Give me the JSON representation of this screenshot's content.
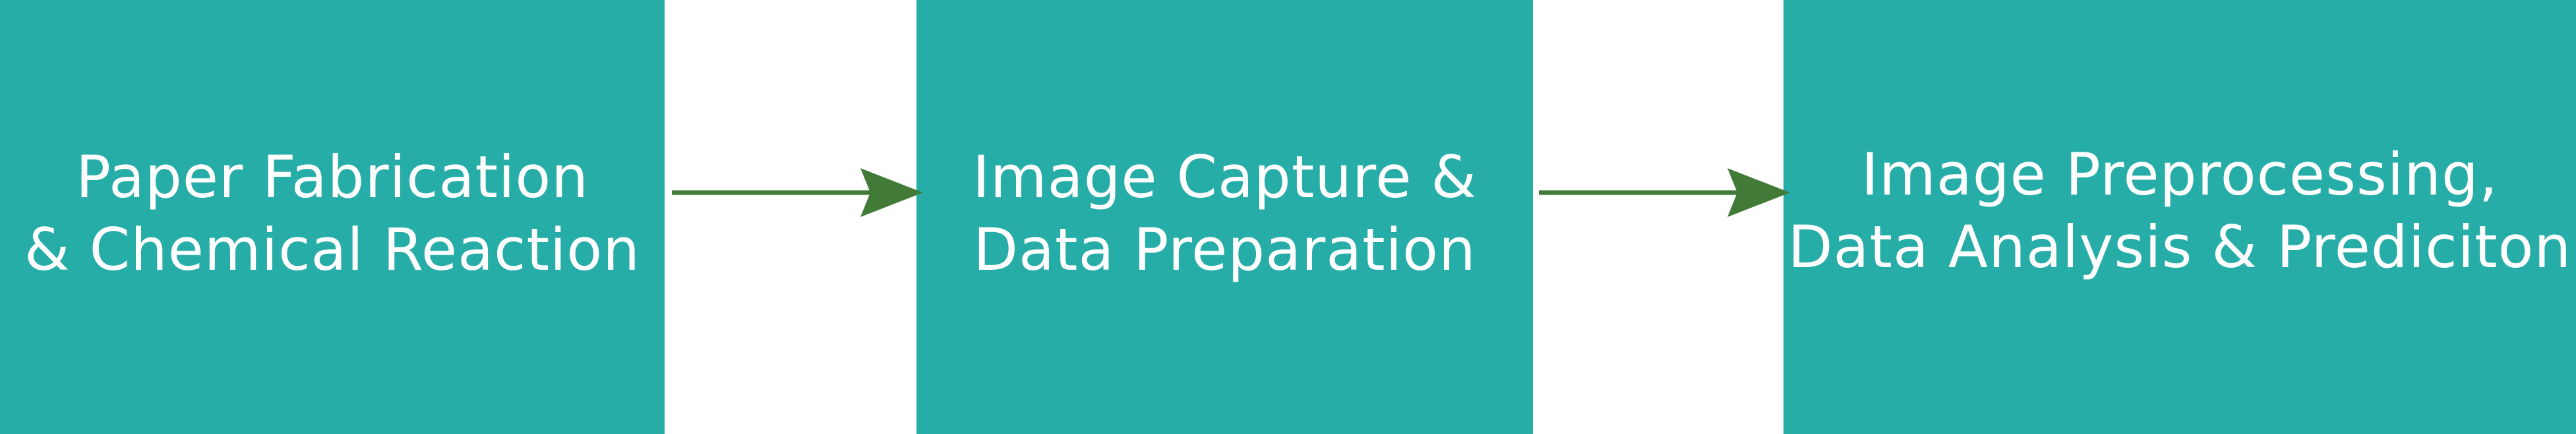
{
  "diagram": {
    "colors": {
      "box_fill": "#27ada8",
      "text": "#ffffff",
      "arrow": "#427b38",
      "background": "#ffffff"
    },
    "steps": [
      {
        "label": "Paper Fabrication\n& Chemical Reaction"
      },
      {
        "label": "Image Capture &\nData Preparation"
      },
      {
        "label": "Image Preprocessing,\nData Analysis & Prediciton"
      }
    ],
    "connections": [
      {
        "from": 0,
        "to": 1
      },
      {
        "from": 1,
        "to": 2
      }
    ]
  }
}
